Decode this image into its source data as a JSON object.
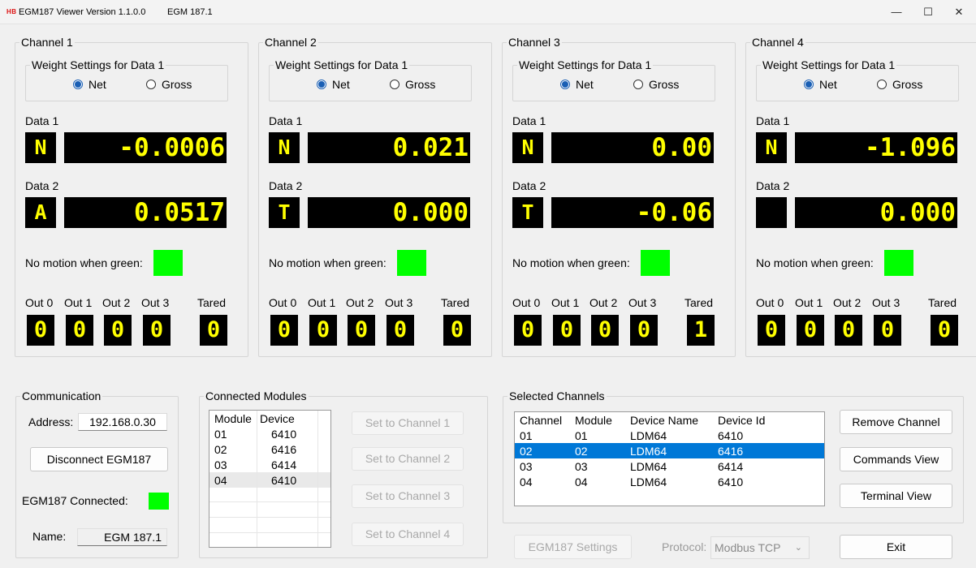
{
  "window": {
    "logo": "HB",
    "title": "EGM187 Viewer Version 1.1.0.0",
    "subtitle": "EGM 187.1",
    "minimize": "—",
    "maximize": "☐",
    "close": "✕"
  },
  "channels": [
    {
      "title": "Channel 1",
      "weight_legend": "Weight Settings for Data 1",
      "net_label": "Net",
      "gross_label": "Gross",
      "selected": "Net",
      "data1_label": "Data 1",
      "data1_letter": "N",
      "data1_value": "-0.0006",
      "data2_label": "Data 2",
      "data2_letter": "A",
      "data2_value": "0.0517",
      "motion_label": "No motion when green:",
      "motion_color": "#00ff00",
      "out_labels": [
        "Out 0",
        "Out 1",
        "Out 2",
        "Out 3"
      ],
      "out_values": [
        "0",
        "0",
        "0",
        "0"
      ],
      "tared_label": "Tared",
      "tared_value": "0"
    },
    {
      "title": "Channel 2",
      "weight_legend": "Weight Settings for Data 1",
      "net_label": "Net",
      "gross_label": "Gross",
      "selected": "Net",
      "data1_label": "Data 1",
      "data1_letter": "N",
      "data1_value": "0.021",
      "data2_label": "Data 2",
      "data2_letter": "T",
      "data2_value": "0.000",
      "motion_label": "No motion when green:",
      "motion_color": "#00ff00",
      "out_labels": [
        "Out 0",
        "Out 1",
        "Out 2",
        "Out 3"
      ],
      "out_values": [
        "0",
        "0",
        "0",
        "0"
      ],
      "tared_label": "Tared",
      "tared_value": "0"
    },
    {
      "title": "Channel 3",
      "weight_legend": "Weight Settings for Data 1",
      "net_label": "Net",
      "gross_label": "Gross",
      "selected": "Net",
      "data1_label": "Data 1",
      "data1_letter": "N",
      "data1_value": "0.00",
      "data2_label": "Data 2",
      "data2_letter": "T",
      "data2_value": "-0.06",
      "motion_label": "No motion when green:",
      "motion_color": "#00ff00",
      "out_labels": [
        "Out 0",
        "Out 1",
        "Out 2",
        "Out 3"
      ],
      "out_values": [
        "0",
        "0",
        "0",
        "0"
      ],
      "tared_label": "Tared",
      "tared_value": "1"
    },
    {
      "title": "Channel 4",
      "weight_legend": "Weight Settings for Data 1",
      "net_label": "Net",
      "gross_label": "Gross",
      "selected": "Net",
      "data1_label": "Data 1",
      "data1_letter": "N",
      "data1_value": "-1.096",
      "data2_label": "Data 2",
      "data2_letter": "",
      "data2_value": "0.000",
      "motion_label": "No motion when green:",
      "motion_color": "#00ff00",
      "out_labels": [
        "Out 0",
        "Out 1",
        "Out 2",
        "Out 3"
      ],
      "out_values": [
        "0",
        "0",
        "0",
        "0"
      ],
      "tared_label": "Tared",
      "tared_value": "0"
    }
  ],
  "communication": {
    "title": "Communication",
    "address_label": "Address:",
    "address_value": "192.168.0.30",
    "disconnect_label": "Disconnect EGM187",
    "connected_label": "EGM187 Connected:",
    "connected_color": "#00ff00",
    "name_label": "Name:",
    "name_value": "EGM 187.1"
  },
  "modules": {
    "title": "Connected Modules",
    "headers": [
      "Module",
      "Device"
    ],
    "rows": [
      [
        "01",
        "6410"
      ],
      [
        "02",
        "6416"
      ],
      [
        "03",
        "6414"
      ],
      [
        "04",
        "6410"
      ]
    ],
    "set_buttons": [
      "Set to Channel 1",
      "Set to Channel 2",
      "Set to Channel 3",
      "Set to Channel 4"
    ]
  },
  "selected_channels": {
    "title": "Selected Channels",
    "headers": [
      "Channel",
      "Module",
      "Device Name",
      "Device Id"
    ],
    "rows": [
      [
        "01",
        "01",
        "LDM64",
        "6410"
      ],
      [
        "02",
        "02",
        "LDM64",
        "6416"
      ],
      [
        "03",
        "03",
        "LDM64",
        "6414"
      ],
      [
        "04",
        "04",
        "LDM64",
        "6410"
      ]
    ],
    "selected_row": "02",
    "remove_label": "Remove Channel",
    "commands_label": "Commands View",
    "terminal_label": "Terminal View"
  },
  "footer": {
    "settings_label": "EGM187 Settings",
    "protocol_label": "Protocol:",
    "protocol_value": "Modbus TCP",
    "exit_label": "Exit"
  },
  "colors": {
    "display_bg": "#000000",
    "display_fg": "#ffff00",
    "led_green": "#00ff00",
    "selection": "#0078d7"
  }
}
